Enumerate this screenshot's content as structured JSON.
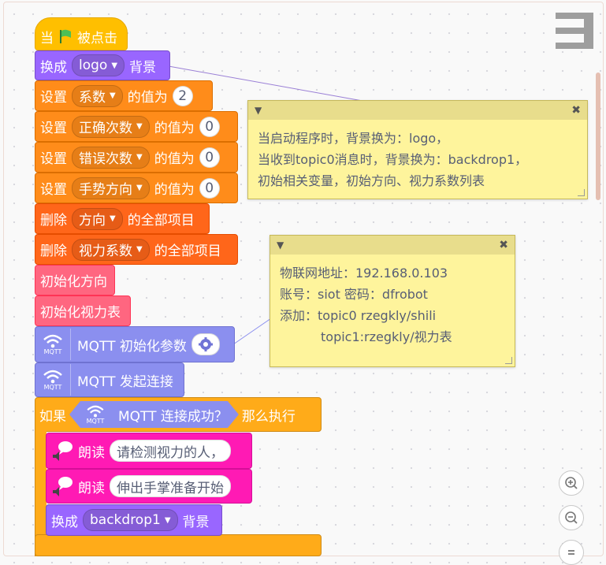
{
  "blocks": {
    "when_flag": {
      "prefix": "当",
      "suffix": "被点击"
    },
    "switch_logo": {
      "label": "换成",
      "value": "logo",
      "suffix": "背景"
    },
    "set_coef": {
      "label": "设置",
      "var": "系数",
      "mid": "的值为",
      "value": "2"
    },
    "set_correct": {
      "label": "设置",
      "var": "正确次数",
      "mid": "的值为",
      "value": "0"
    },
    "set_wrong": {
      "label": "设置",
      "var": "错误次数",
      "mid": "的值为",
      "value": "0"
    },
    "set_gesture": {
      "label": "设置",
      "var": "手势方向",
      "mid": "的值为",
      "value": "0"
    },
    "delete_dir": {
      "label": "删除",
      "list": "方向",
      "suffix": "的全部项目"
    },
    "delete_vision": {
      "label": "删除",
      "list": "视力系数",
      "suffix": "的全部项目"
    },
    "init_dir": {
      "label": "初始化方向"
    },
    "init_vision": {
      "label": "初始化视力表"
    },
    "mqtt_init": {
      "label": "MQTT 初始化参数"
    },
    "mqtt_connect": {
      "label": "MQTT 发起连接"
    },
    "if_block": {
      "prefix": "如果",
      "condition": "MQTT 连接成功？",
      "suffix": "那么执行"
    },
    "speak1": {
      "label": "朗读",
      "text": "请检测视力的人，"
    },
    "speak2": {
      "label": "朗读",
      "text": "伸出手掌准备开始"
    },
    "switch_backdrop": {
      "label": "换成",
      "value": "backdrop1",
      "suffix": "背景"
    },
    "mqtt_icon_text": "MQTT"
  },
  "comments": [
    {
      "lines": [
        "当启动程序时，背景换为：logo，",
        "当收到topic0消息时，背景换为：backdrop1，",
        "初始相关变量，初始方向、视力系数列表"
      ]
    },
    {
      "lines": [
        "物联网地址：192.168.0.103",
        "账号：siot 密码：dfrobot",
        "添加：topic0 rzegkly/shili",
        "topic1:rzegkly/视力表"
      ]
    }
  ],
  "colors": {
    "events": "#ffbf00",
    "looks": "#9966ff",
    "variables": "#ff8c1a",
    "lists": "#ff661a",
    "custom": "#ff6680",
    "extension": "#8b8fef",
    "control": "#ffab19",
    "text_to_speech": "#ff1ab4",
    "comment": "#fef49c"
  },
  "icons": [
    "green-flag-icon",
    "dropdown-caret-icon",
    "wifi-icon",
    "gear-icon",
    "speaker-icon",
    "zoom-in-icon",
    "zoom-out-icon",
    "zoom-reset-icon",
    "menu-icon",
    "close-icon"
  ]
}
